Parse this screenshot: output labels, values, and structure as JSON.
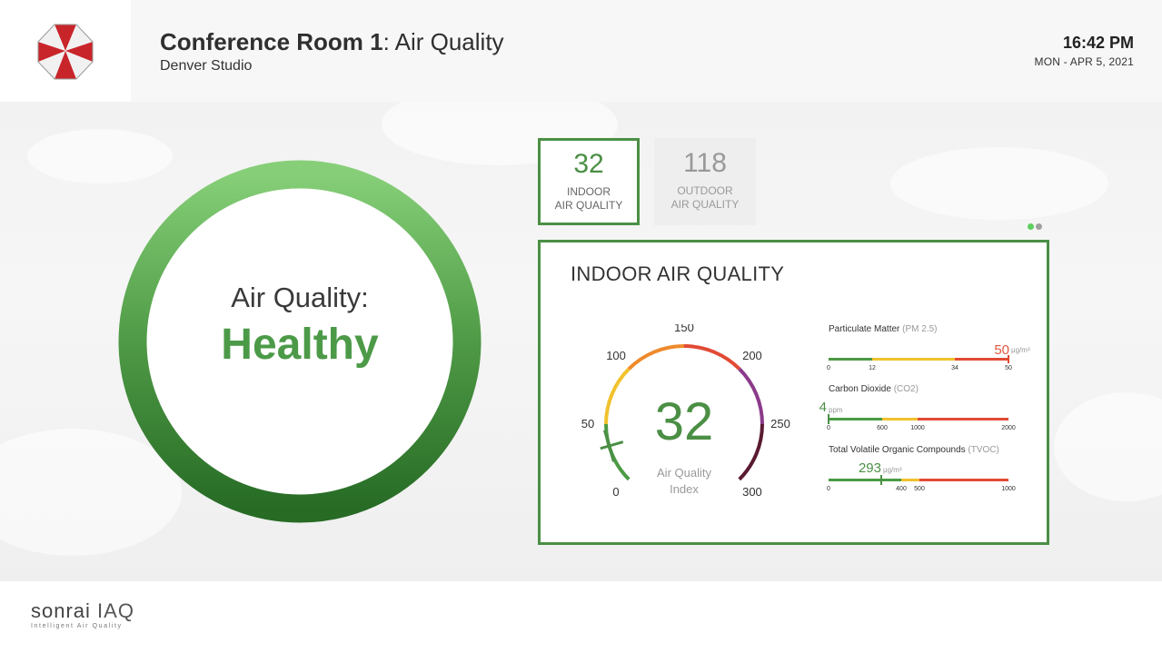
{
  "header": {
    "room_name": "Conference Room 1",
    "title_suffix": ": Air Quality",
    "location": "Denver Studio",
    "time": "16:42 PM",
    "date": "MON - APR 5, 2021",
    "logo_icon": "umbrella-logo-icon"
  },
  "status_ring": {
    "label": "Air Quality:",
    "status": "Healthy",
    "color": "#4c9a48"
  },
  "tiles": {
    "indoor": {
      "value": "32",
      "label_line1": "INDOOR",
      "label_line2": "AIR QUALITY"
    },
    "outdoor": {
      "value": "118",
      "label_line1": "OUTDOOR",
      "label_line2": "AIR QUALITY"
    }
  },
  "pager": {
    "active_color": "#5ccf5c",
    "inactive_color": "#a0a0a0",
    "count": 2,
    "active_index": 0
  },
  "panel": {
    "title": "INDOOR AIR QUALITY",
    "gauge": {
      "value": 32,
      "value_text": "32",
      "min": 0,
      "max": 300,
      "label_line1": "Air Quality",
      "label_line2": "Index",
      "ticks": [
        "0",
        "50",
        "100",
        "150",
        "200",
        "250",
        "300"
      ]
    },
    "metrics": [
      {
        "name": "Particulate Matter",
        "abbr": "(PM 2.5)",
        "value": "50",
        "unit": "μg/m³",
        "value_color": "#e0563f",
        "ticks": [
          "0",
          "12",
          "34",
          "50"
        ]
      },
      {
        "name": "Carbon Dioxide",
        "abbr": "(CO2)",
        "value": "4",
        "unit": "ppm",
        "value_color": "#4b8f45",
        "ticks": [
          "0",
          "600",
          "1000",
          "2000"
        ]
      },
      {
        "name": "Total Volatile Organic Compounds",
        "abbr": "(TVOC)",
        "value": "293",
        "unit": "μg/m³",
        "value_color": "#4b8f45",
        "ticks": [
          "0",
          "400",
          "500",
          "1000"
        ]
      }
    ]
  },
  "footer": {
    "brand": "sonrai",
    "brand_suffix": "IAQ",
    "tagline": "Intelligent Air Quality"
  }
}
